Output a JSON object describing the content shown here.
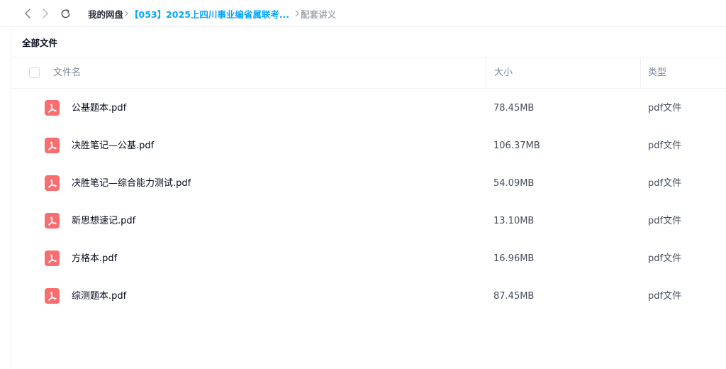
{
  "breadcrumb": {
    "root": "我的网盘",
    "folder": "【053】2025上四川事业编省属联考...",
    "current": "配套讲义"
  },
  "section": {
    "title": "全部文件"
  },
  "table": {
    "headers": {
      "name": "文件名",
      "size": "大小",
      "type": "类型"
    },
    "rows": [
      {
        "name": "公基题本.pdf",
        "size": "78.45MB",
        "type": "pdf文件"
      },
      {
        "name": "决胜笔记—公基.pdf",
        "size": "106.37MB",
        "type": "pdf文件"
      },
      {
        "name": "决胜笔记—综合能力测试.pdf",
        "size": "54.09MB",
        "type": "pdf文件"
      },
      {
        "name": "新思想速记.pdf",
        "size": "13.10MB",
        "type": "pdf文件"
      },
      {
        "name": "方格本.pdf",
        "size": "16.96MB",
        "type": "pdf文件"
      },
      {
        "name": "综测题本.pdf",
        "size": "87.45MB",
        "type": "pdf文件"
      }
    ]
  },
  "colors": {
    "accent": "#06a7ff",
    "pdf_icon": "#f76d70",
    "text": "#03081a",
    "muted": "#818999"
  },
  "icons": {
    "back": "chevron-left-icon",
    "forward": "chevron-right-icon",
    "refresh": "refresh-icon",
    "file": "pdf-file-icon"
  }
}
